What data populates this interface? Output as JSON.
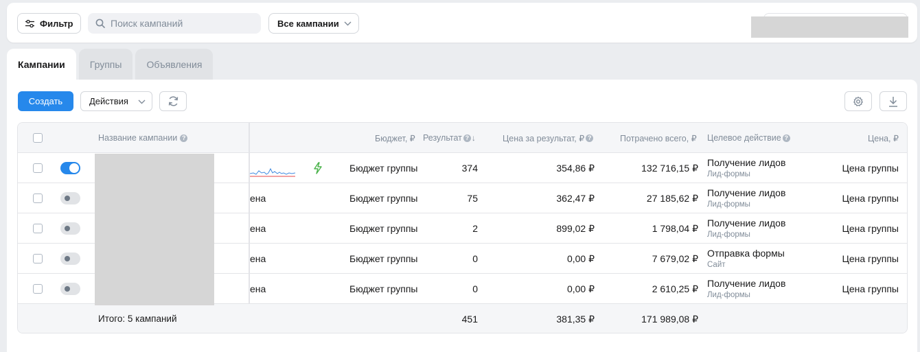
{
  "topbar": {
    "filter_label": "Фильтр",
    "search_placeholder": "Поиск кампаний",
    "campaigns_select": "Все кампании"
  },
  "tabs": [
    {
      "label": "Кампании",
      "active": true
    },
    {
      "label": "Группы",
      "active": false
    },
    {
      "label": "Объявления",
      "active": false
    }
  ],
  "toolbar": {
    "create_label": "Создать",
    "actions_label": "Действия"
  },
  "table": {
    "headers": {
      "name": "Название кампании",
      "budget": "Бюджет, ₽",
      "result": "Результат",
      "cost_per_result": "Цена за результат, ₽",
      "spent": "Потрачено всего, ₽",
      "target": "Целевое действие",
      "price": "Цена, ₽"
    },
    "rows": [
      {
        "enabled": true,
        "name_tail": "",
        "budget": "Бюджет группы",
        "result": "374",
        "cost": "354,86 ₽",
        "spent": "132 716,15 ₽",
        "target": "Получение лидов",
        "target_sub": "Лид-формы",
        "price": "Цена группы"
      },
      {
        "enabled": false,
        "name_tail": "ена",
        "budget": "Бюджет группы",
        "result": "75",
        "cost": "362,47 ₽",
        "spent": "27 185,62 ₽",
        "target": "Получение лидов",
        "target_sub": "Лид-формы",
        "price": "Цена группы"
      },
      {
        "enabled": false,
        "name_tail": "ена",
        "budget": "Бюджет группы",
        "result": "2",
        "cost": "899,02 ₽",
        "spent": "1 798,04 ₽",
        "target": "Получение лидов",
        "target_sub": "Лид-формы",
        "price": "Цена группы"
      },
      {
        "enabled": false,
        "name_tail": "ена",
        "budget": "Бюджет группы",
        "result": "0",
        "cost": "0,00 ₽",
        "spent": "7 679,02 ₽",
        "target": "Отправка формы",
        "target_sub": "Сайт",
        "price": "Цена группы"
      },
      {
        "enabled": false,
        "name_tail": "ена",
        "budget": "Бюджет группы",
        "result": "0",
        "cost": "0,00 ₽",
        "spent": "2 610,25 ₽",
        "target": "Получение лидов",
        "target_sub": "Лид-формы",
        "price": "Цена группы"
      }
    ],
    "totals": {
      "label": "Итого: 5 кампаний",
      "result": "451",
      "cost": "381,35 ₽",
      "spent": "171 989,08 ₽"
    }
  },
  "colors": {
    "primary": "#2688eb",
    "lightning": "#4bb34b",
    "sparkline_blue": "#3f8ae0",
    "sparkline_red": "#e64646"
  }
}
